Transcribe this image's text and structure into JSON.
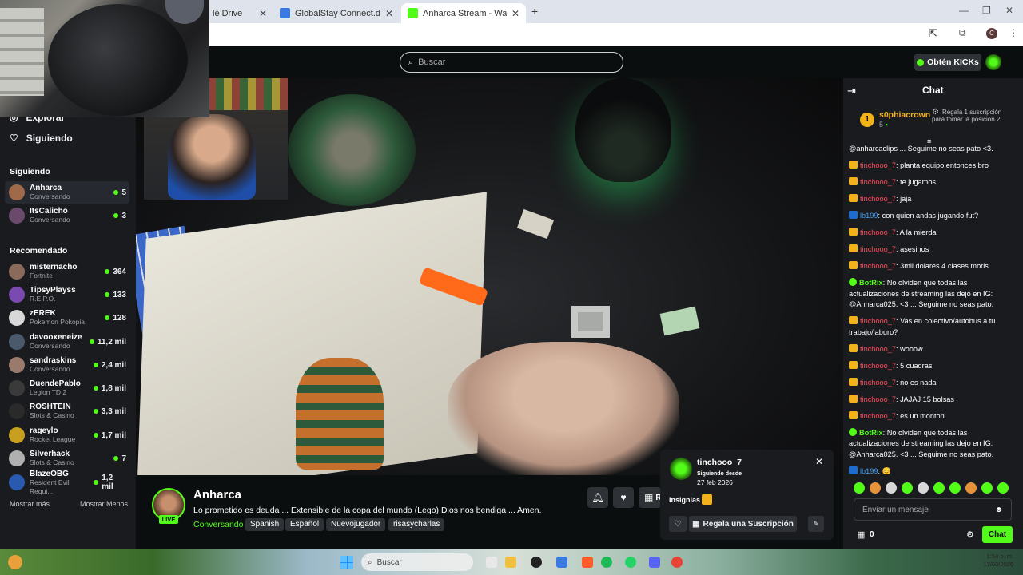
{
  "browser": {
    "tabs": [
      {
        "label": "le Drive"
      },
      {
        "label": "GlobalStay Connect.docx - Goo"
      },
      {
        "label": "Anharca Stream - Watch Live o"
      }
    ],
    "profile_initial": "C"
  },
  "header": {
    "search_placeholder": "Buscar",
    "get_kicks_label": "Obtén KICKs"
  },
  "sidebar": {
    "nav": [
      {
        "label": "Explorar"
      },
      {
        "label": "Siguiendo"
      }
    ],
    "following_heading": "Siguiendo",
    "following": [
      {
        "name": "Anharca",
        "category": "Conversando",
        "viewers": "5"
      },
      {
        "name": "ItsCalicho",
        "category": "Conversando",
        "viewers": "3"
      }
    ],
    "recommended_heading": "Recomendado",
    "recommended": [
      {
        "name": "misternacho",
        "category": "Fortnite",
        "viewers": "364"
      },
      {
        "name": "TipsyPlayss",
        "category": "R.E.P.O.",
        "viewers": "133"
      },
      {
        "name": "zEREK",
        "category": "Pokemon Pokopia",
        "viewers": "128"
      },
      {
        "name": "davooxeneize",
        "category": "Conversando",
        "viewers": "11,2 mil"
      },
      {
        "name": "sandraskins",
        "category": "Conversando",
        "viewers": "2,4 mil"
      },
      {
        "name": "DuendePablo",
        "category": "Legion TD 2",
        "viewers": "1,8 mil"
      },
      {
        "name": "ROSHTEIN",
        "category": "Slots & Casino",
        "viewers": "3,3 mil"
      },
      {
        "name": "rageylo",
        "category": "Rocket League",
        "viewers": "1,7 mil"
      },
      {
        "name": "Silverhack",
        "category": "Slots & Casino",
        "viewers": "7"
      },
      {
        "name": "BlazeOBG",
        "category": "Resident Evil Requi...",
        "viewers": "1,2 mil"
      }
    ],
    "show_more": "Mostrar más",
    "show_less": "Mostrar Menos"
  },
  "stream": {
    "live_badge": "LIVE",
    "channel_name": "Anharca",
    "title": "Lo prometido es deuda ... Extensible de la copa del mundo (Lego) Dios nos bendiga ... Amen.",
    "category": "Conversando",
    "tags": [
      "Spanish",
      "Español",
      "Nuevojugador",
      "risasycharlas"
    ],
    "gift_btn_partial": "R"
  },
  "user_card": {
    "username": "tinchooo_7",
    "following_since_label": "Siguiendo desde",
    "following_since": "27 feb 2026",
    "badges_label": "Insignias",
    "gift_sub_label": "Regala una Suscripción"
  },
  "chat": {
    "title": "Chat",
    "pinned": {
      "rank": "1",
      "username": "s0phiacrown",
      "count": "5",
      "gift_text": "Regala 1 suscripción para tomar la posición 2"
    },
    "messages": [
      {
        "badge": "none",
        "user": "",
        "user_color": "white",
        "text": "@anharcaclips ... Seguime no seas pato <3."
      },
      {
        "badge": "crown",
        "user": "tinchooo_7",
        "user_color": "red",
        "text": "planta equipo entonces bro"
      },
      {
        "badge": "crown",
        "user": "tinchooo_7",
        "user_color": "red",
        "text": "te jugamos"
      },
      {
        "badge": "crown",
        "user": "tinchooo_7",
        "user_color": "red",
        "text": "jaja"
      },
      {
        "badge": "arrow",
        "user": "lb199",
        "user_color": "blue",
        "text": "con quien andas jugando fut?"
      },
      {
        "badge": "crown",
        "user": "tinchooo_7",
        "user_color": "red",
        "text": "A la mierda"
      },
      {
        "badge": "crown",
        "user": "tinchooo_7",
        "user_color": "red",
        "text": "asesinos"
      },
      {
        "badge": "crown",
        "user": "tinchooo_7",
        "user_color": "red",
        "text": "3mil dolares 4 clases moris"
      },
      {
        "badge": "bot",
        "user": "BotRix",
        "user_color": "green",
        "text": "No olviden que todas las actualizaciones de streaming las dejo en IG: @Anharca025. <3 ... Seguime no seas pato."
      },
      {
        "badge": "crown",
        "user": "tinchooo_7",
        "user_color": "red",
        "text": "Vas en colectivo/autobus a tu trabajo/laburo?"
      },
      {
        "badge": "crown",
        "user": "tinchooo_7",
        "user_color": "red",
        "text": "wooow"
      },
      {
        "badge": "crown",
        "user": "tinchooo_7",
        "user_color": "red",
        "text": "5 cuadras"
      },
      {
        "badge": "crown",
        "user": "tinchooo_7",
        "user_color": "red",
        "text": "no es nada"
      },
      {
        "badge": "crown",
        "user": "tinchooo_7",
        "user_color": "red",
        "text": "JAJAJ 15 bolsas"
      },
      {
        "badge": "crown",
        "user": "tinchooo_7",
        "user_color": "red",
        "text": "es un monton"
      },
      {
        "badge": "bot",
        "user": "BotRix",
        "user_color": "green",
        "text": "No olviden que todas las actualizaciones de streaming las dejo en IG: @Anharca025. <3 ... Seguime no seas pato."
      },
      {
        "badge": "arrow",
        "user": "lb199",
        "user_color": "blue",
        "text": "😊"
      }
    ],
    "input_placeholder": "Enviar un mensaje",
    "points": "0",
    "send_label": "Chat"
  },
  "taskbar": {
    "search_placeholder": "Buscar",
    "time": "1:54 p. m.",
    "date": "17/03/2026"
  }
}
